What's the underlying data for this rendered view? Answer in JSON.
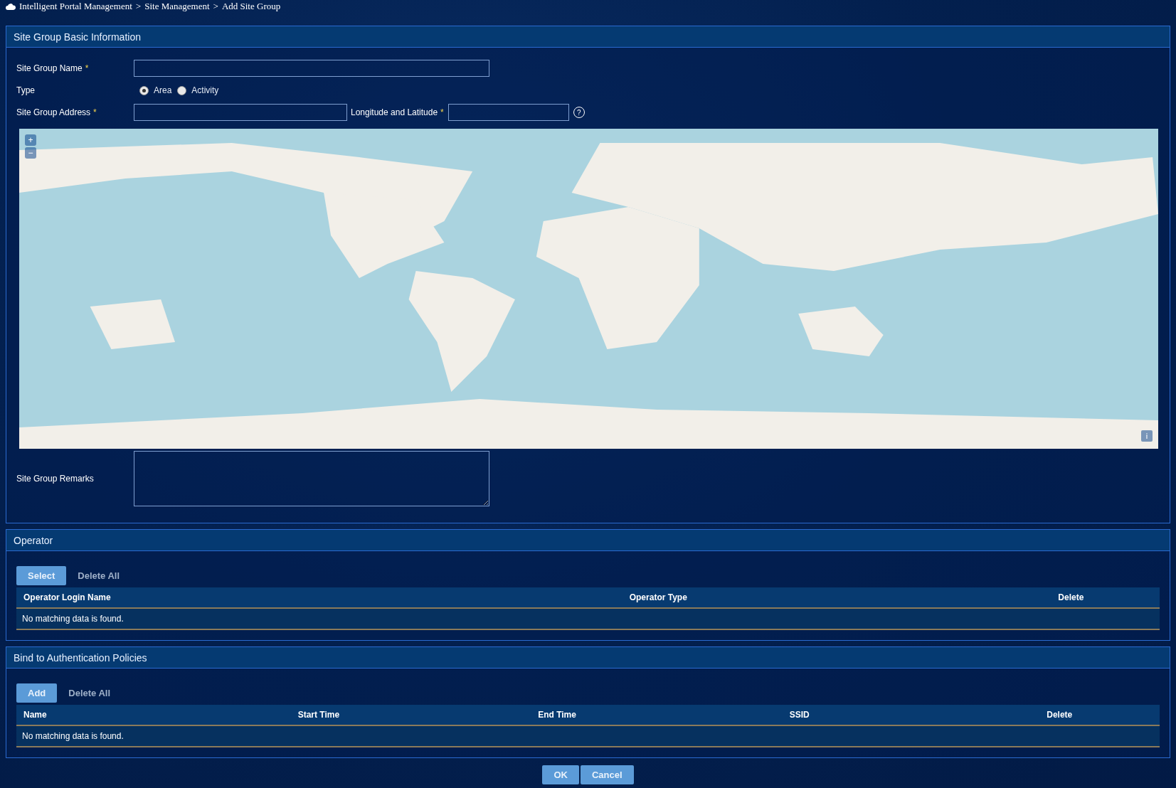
{
  "breadcrumb": {
    "items": [
      "Intelligent Portal Management",
      "Site Management",
      "Add Site Group"
    ],
    "separator": ">"
  },
  "required_mark": "*",
  "basic_info": {
    "title": "Site Group Basic Information",
    "name_field": {
      "label": "Site Group Name",
      "required": true
    },
    "type_field": {
      "label": "Type",
      "options": [
        {
          "label": "Area",
          "selected": true
        },
        {
          "label": "Activity",
          "selected": false
        }
      ]
    },
    "address_field": {
      "label": "Site Group Address",
      "required": true
    },
    "coordinates_field": {
      "label": "Longitude and Latitude",
      "required": true,
      "help": "?"
    },
    "map": {
      "zoom_in": "+",
      "zoom_out": "−",
      "info": "i"
    },
    "remarks_field": {
      "label": "Site Group Remarks"
    }
  },
  "operator": {
    "title": "Operator",
    "buttons": [
      {
        "label": "Select",
        "kind": "primary"
      },
      {
        "label": "Delete All",
        "kind": "plain"
      }
    ],
    "columns": [
      "Operator Login Name",
      "Operator Type",
      "Delete"
    ],
    "empty_text": "No matching data is found."
  },
  "auth_policies": {
    "title": "Bind to Authentication Policies",
    "buttons": [
      {
        "label": "Add",
        "kind": "primary"
      },
      {
        "label": "Delete All",
        "kind": "plain"
      }
    ],
    "columns": [
      "Name",
      "Start Time",
      "End Time",
      "SSID",
      "Delete"
    ],
    "empty_text": "No matching data is found."
  },
  "footer_buttons": [
    "OK",
    "Cancel"
  ]
}
